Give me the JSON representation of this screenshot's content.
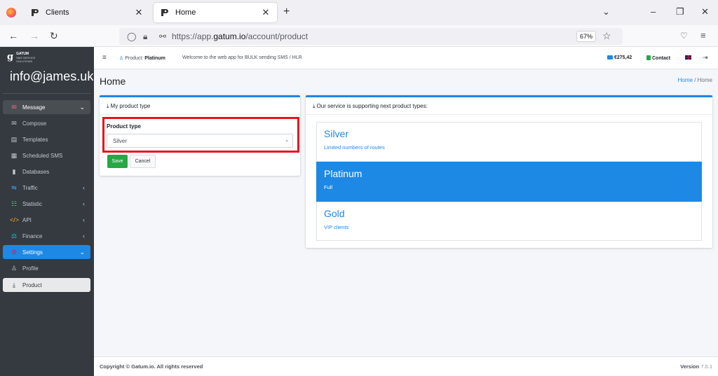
{
  "browser": {
    "tabs": [
      {
        "label": "Clients",
        "active": false
      },
      {
        "label": "Home",
        "active": true
      }
    ],
    "url_prefix": "https://app.",
    "url_domain": "gatum.io",
    "url_path": "/account/product",
    "zoom": "67%"
  },
  "sidebar": {
    "brand_name": "GATUM",
    "brand_tagline": "SMS SERVICE SOLUTIONS",
    "user_email": "info@james.uk",
    "items": [
      {
        "label": "Message",
        "icon": "message-icon",
        "arrow": "chevron-down"
      },
      {
        "label": "Compose",
        "icon": "envelope-icon"
      },
      {
        "label": "Templates",
        "icon": "template-icon"
      },
      {
        "label": "Scheduled SMS",
        "icon": "calendar-icon"
      },
      {
        "label": "Databases",
        "icon": "database-icon"
      },
      {
        "label": "Traffic",
        "icon": "traffic-icon",
        "arrow": "chevron-left"
      },
      {
        "label": "Statistic",
        "icon": "statistic-icon",
        "arrow": "chevron-left"
      },
      {
        "label": "API",
        "icon": "code-icon",
        "arrow": "chevron-left"
      },
      {
        "label": "Finance",
        "icon": "finance-icon",
        "arrow": "chevron-left"
      },
      {
        "label": "Settings",
        "icon": "settings-icon",
        "arrow": "chevron-down"
      },
      {
        "label": "Profile",
        "icon": "user-icon"
      },
      {
        "label": "Product",
        "icon": "download-icon"
      }
    ]
  },
  "topbar": {
    "product_prefix": "Product:",
    "product_name": "Platinum",
    "welcome": "Welcome to the web app for BULK sending SMS / HLR",
    "balance": "€275,42",
    "contact": "Contact"
  },
  "page": {
    "title": "Home",
    "breadcrumb_link": "Home",
    "breadcrumb_sep": "/",
    "breadcrumb_current": "Home"
  },
  "product_card": {
    "header": "My product type",
    "field_label": "Product type",
    "selected": "Silver",
    "save_label": "Save",
    "cancel_label": "Cancel"
  },
  "service_card": {
    "header": "Our service is supporting next product types:",
    "types": [
      {
        "name": "Silver",
        "desc": "Limited numbers of routes",
        "active": false
      },
      {
        "name": "Platinum",
        "desc": "Full",
        "active": true
      },
      {
        "name": "Gold",
        "desc": "VIP clients",
        "active": false
      }
    ]
  },
  "footer": {
    "copyright": "Copyright © Gatum.io. All rights reserved",
    "version_label": "Version",
    "version_number": "7.0.1"
  },
  "colors": {
    "accent": "#1e88e5",
    "sidebar": "#343a40",
    "save": "#28a745",
    "highlight": "#e8141f"
  }
}
